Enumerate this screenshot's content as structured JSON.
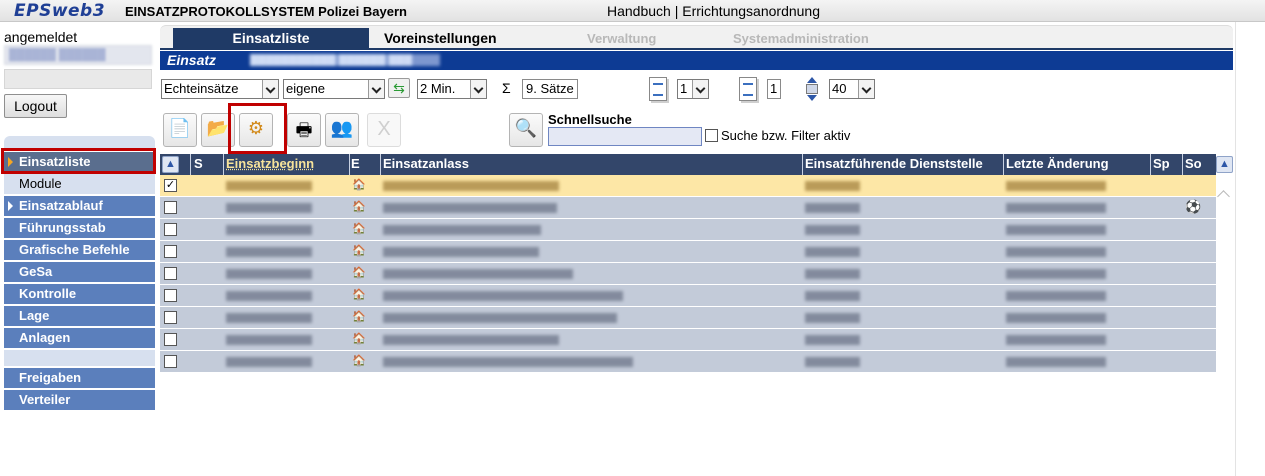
{
  "titlebar": {
    "logo": "EPSweb3",
    "app_title": "EINSATZPROTOKOLLSYSTEM Polizei Bayern",
    "link_handbook": "Handbuch",
    "link_separator": " | ",
    "link_order": "Errichtungsanordnung"
  },
  "left": {
    "login_label": "angemeldet",
    "login_user": "██████ ██████",
    "logout": "Logout",
    "nav": [
      {
        "label": "Einsatzliste"
      },
      {
        "label": "Module"
      },
      {
        "label": "Einsatzablauf"
      },
      {
        "label": "Führungsstab"
      },
      {
        "label": "Grafische Befehle"
      },
      {
        "label": "GeSa"
      },
      {
        "label": "Kontrolle"
      },
      {
        "label": "Lage"
      },
      {
        "label": "Anlagen"
      },
      {
        "label": "Freigaben"
      },
      {
        "label": "Verteiler"
      }
    ]
  },
  "tabs": {
    "einsatzliste": "Einsatzliste",
    "voreinstellungen": "Voreinstellungen",
    "verwaltung": "Verwaltung",
    "systemadministration": "Systemadministration"
  },
  "einsatz_bar": {
    "label": "Einsatz",
    "name": "███████████ ██████ ███"
  },
  "filters": {
    "scope": "Echteinsätze",
    "owner": "eigene",
    "interval": "2 Min.",
    "sigma": "Σ",
    "count": "9. Sätze",
    "page": "1",
    "pages": "1",
    "rows_per_page": "40"
  },
  "toolbar": {
    "disabled_label": "X",
    "quick_search_label": "Schnellsuche",
    "quick_search_value": "",
    "filter_active_label": "Suche bzw. Filter aktiv"
  },
  "table": {
    "headers": {
      "s": "S",
      "start": "Einsatzbeginn",
      "e": "E",
      "reason": "Einsatzanlass",
      "unit": "Einsatzführende Dienststelle",
      "changed": "Letzte Änderung",
      "sp": "Sp",
      "so": "So"
    },
    "rows": [
      {
        "checked": "✓",
        "selected": true,
        "so": ""
      },
      {
        "checked": "",
        "selected": false,
        "so": "⚽"
      },
      {
        "checked": "",
        "selected": false,
        "so": ""
      },
      {
        "checked": "",
        "selected": false,
        "so": ""
      },
      {
        "checked": "",
        "selected": false,
        "so": ""
      },
      {
        "checked": "",
        "selected": false,
        "so": ""
      },
      {
        "checked": "",
        "selected": false,
        "so": ""
      },
      {
        "checked": "",
        "selected": false,
        "so": ""
      },
      {
        "checked": "",
        "selected": false,
        "so": ""
      }
    ]
  },
  "colors": {
    "nav_blue": "#5b7fbc",
    "header_navy": "#33466a",
    "einsatz_blue": "#0d3b94",
    "selected_row": "#fde7a6",
    "row_bg": "#c3cbd9",
    "highlight_red": "#c00000"
  }
}
